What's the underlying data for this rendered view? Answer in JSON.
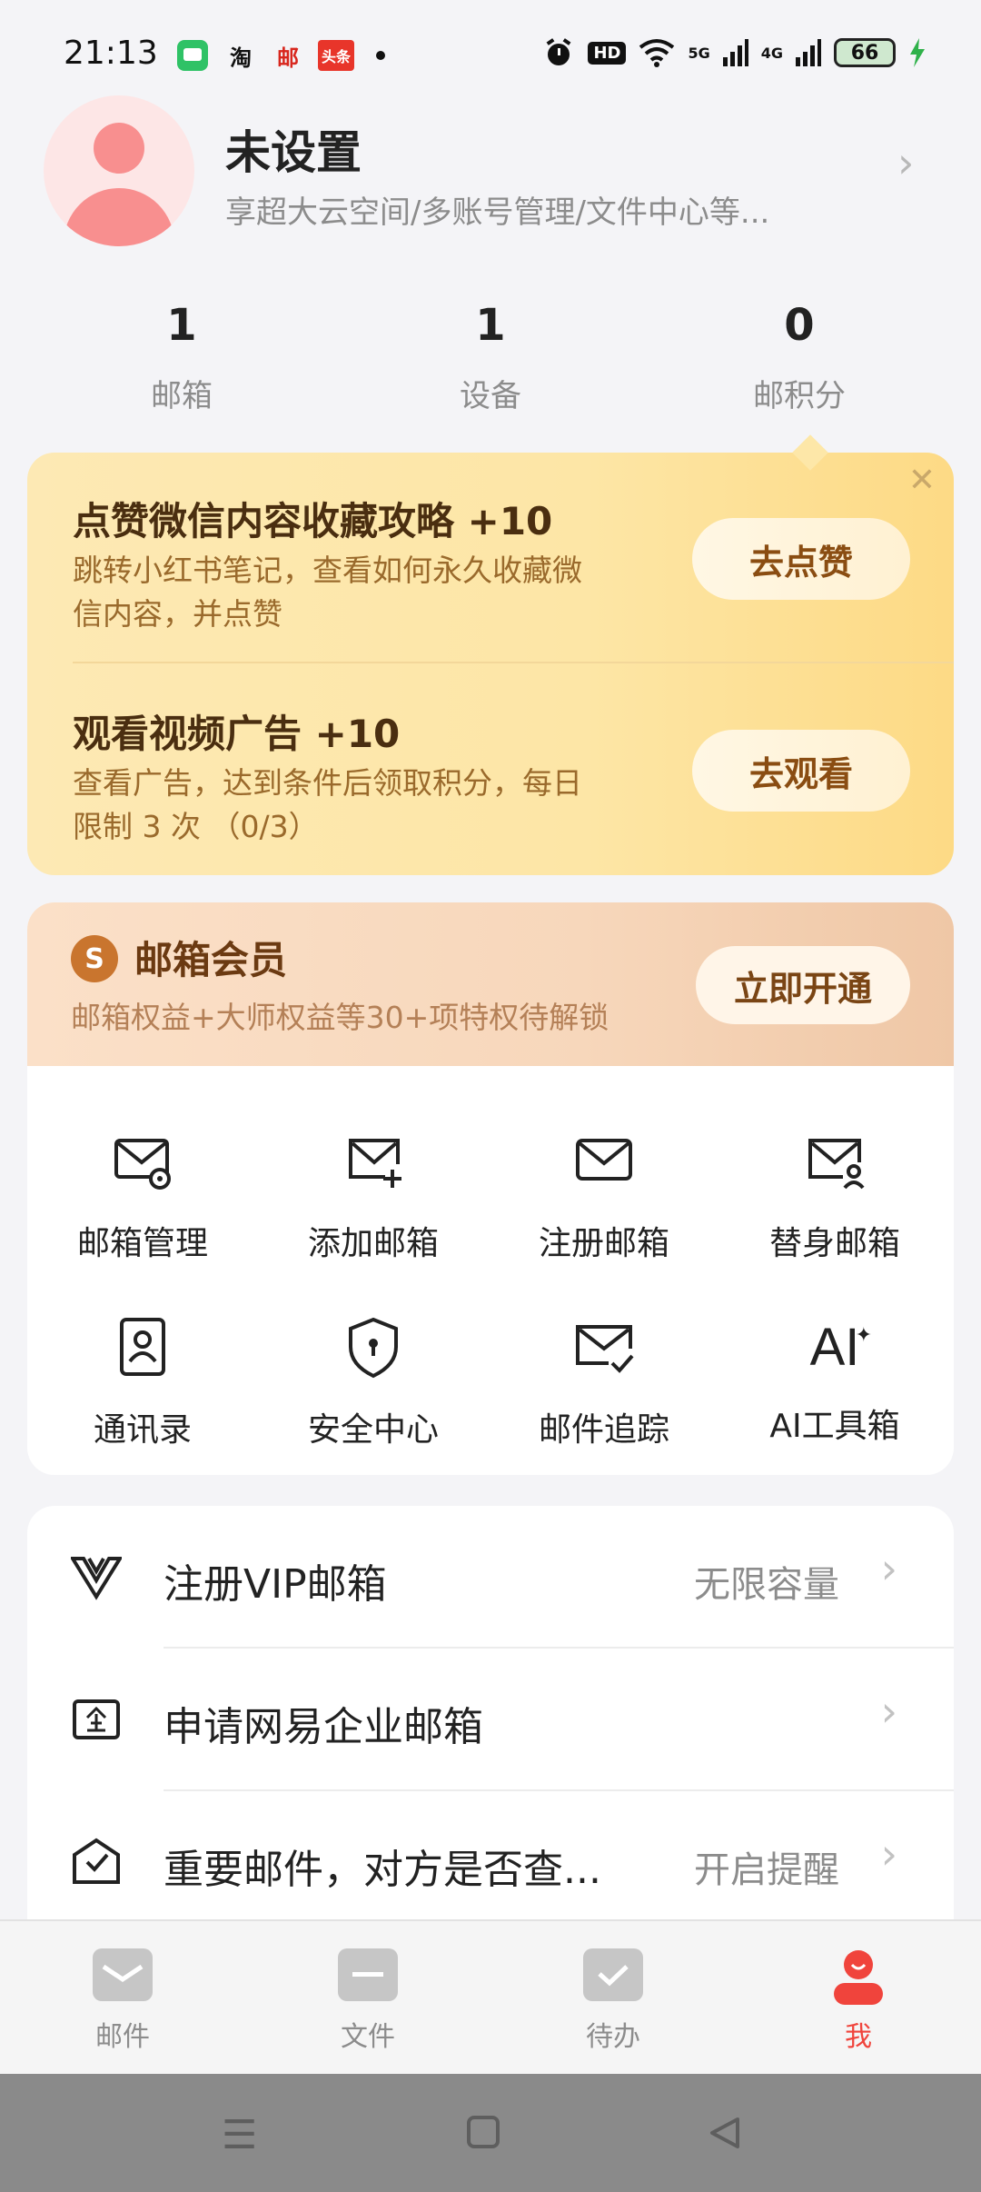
{
  "status_bar": {
    "time": "21:13",
    "apps": [
      "wechat-icon",
      "taobao-icon",
      "post-icon",
      "toutiao-icon"
    ],
    "taobao_label": "淘",
    "post_label": "邮",
    "toutiao_label": "头条",
    "signal_5g": "5G",
    "signal_4g": "4G",
    "hd_label": "HD",
    "battery": "66"
  },
  "profile": {
    "name": "未设置",
    "subtitle": "享超大云空间/多账号管理/文件中心等..."
  },
  "stats": [
    {
      "value": "1",
      "label": "邮箱"
    },
    {
      "value": "1",
      "label": "设备"
    },
    {
      "value": "0",
      "label": "邮积分"
    }
  ],
  "tasks": [
    {
      "title": "点赞微信内容收藏攻略 +10",
      "desc_line1": "跳转小红书笔记，查看如何永久收藏微",
      "desc_line2": "信内容，并点赞",
      "button": "去点赞"
    },
    {
      "title": "观看视频广告 +10",
      "desc_line1": "查看广告，达到条件后领取积分，每日",
      "desc_line2": "限制 3 次 （0/3）",
      "button": "去观看"
    }
  ],
  "vip": {
    "title": "邮箱会员",
    "desc": "邮箱权益+大师权益等30+项特权待解锁",
    "button": "立即开通",
    "badge": "S"
  },
  "tools": [
    {
      "label": "邮箱管理",
      "icon": "mailbox-settings-icon"
    },
    {
      "label": "添加邮箱",
      "icon": "mail-add-icon"
    },
    {
      "label": "注册邮箱",
      "icon": "mail-icon"
    },
    {
      "label": "替身邮箱",
      "icon": "mail-user-icon"
    },
    {
      "label": "通讯录",
      "icon": "contacts-icon"
    },
    {
      "label": "安全中心",
      "icon": "shield-icon"
    },
    {
      "label": "邮件追踪",
      "icon": "mail-check-icon"
    },
    {
      "label": "AI工具箱",
      "icon": "ai-icon"
    }
  ],
  "ai_glyph": "AI",
  "list": [
    {
      "label": "注册VIP邮箱",
      "value": "无限容量",
      "icon": "vip-logo-icon"
    },
    {
      "label": "申请网易企业邮箱",
      "value": "",
      "icon": "enterprise-icon"
    },
    {
      "label": "重要邮件，对方是否查...",
      "value": "开启提醒",
      "icon": "mail-read-icon"
    }
  ],
  "tabs": [
    {
      "label": "邮件",
      "icon": "mail-tab-icon",
      "active": false
    },
    {
      "label": "文件",
      "icon": "folder-tab-icon",
      "active": false
    },
    {
      "label": "待办",
      "icon": "todo-tab-icon",
      "active": false
    },
    {
      "label": "我",
      "icon": "me-tab-icon",
      "active": true
    }
  ],
  "colors": {
    "accent": "#f0443c",
    "task_bg": "#fde6a6",
    "vip_bg": "#f7d7bb"
  }
}
